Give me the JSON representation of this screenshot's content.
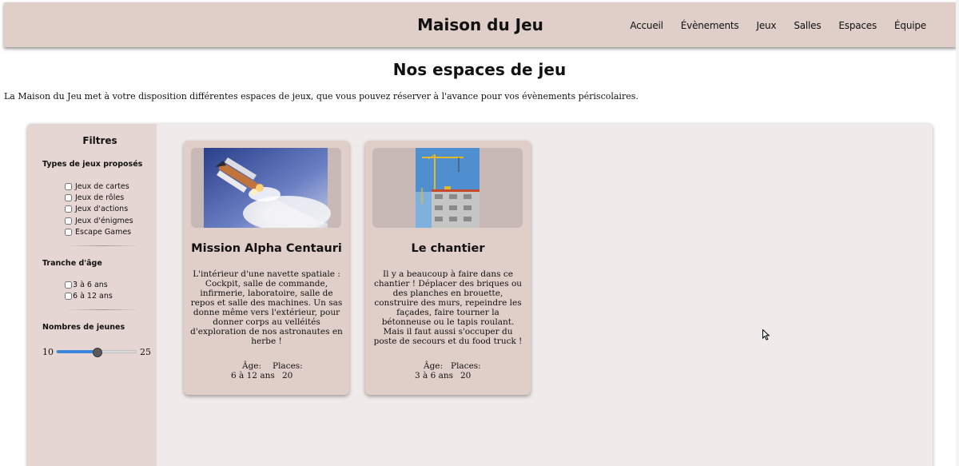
{
  "header": {
    "site_title": "Maison du Jeu",
    "nav": [
      {
        "label": "Accueil"
      },
      {
        "label": "Évènements"
      },
      {
        "label": "Jeux"
      },
      {
        "label": "Salles"
      },
      {
        "label": "Espaces"
      },
      {
        "label": "Équipe"
      }
    ]
  },
  "main": {
    "heading": "Nos espaces de jeu",
    "intro": "La Maison du Jeu met à votre disposition différentes espaces de jeux, que vous pouvez réserver à l'avance pour vos évènements périscolaires."
  },
  "filters": {
    "title": "Filtres",
    "game_types": {
      "title": "Types de jeux proposés",
      "options": [
        {
          "label": "Jeux de cartes",
          "checked": false
        },
        {
          "label": "Jeux de rôles",
          "checked": false
        },
        {
          "label": "Jeux d'actions",
          "checked": false
        },
        {
          "label": "Jeux d'énigmes",
          "checked": false
        },
        {
          "label": "Escape Games",
          "checked": false
        }
      ]
    },
    "age_range": {
      "title": "Tranche d'âge",
      "options": [
        {
          "label": "3 à 6 ans",
          "checked": false
        },
        {
          "label": "6 à 12 ans",
          "checked": false
        }
      ]
    },
    "players": {
      "title": "Nombres de jeunes",
      "min_label": "10",
      "max_label": "25",
      "value_fraction": 0.5
    }
  },
  "cards": [
    {
      "title": "Mission Alpha Centauri",
      "image_icon": "space-shuttle-launch-photo",
      "description": "L'intérieur d'une navette spatiale : Cockpit, salle de commande, infirmerie, laboratoire, salle de repos et salle des machines. Un sas donne même vers l'extérieur, pour donner corps au velléités d'exploration de nos astronautes en herbe !",
      "age_label": "Âge:",
      "age_value": "6 à 12 ans",
      "places_label": "Places:",
      "places_value": "20"
    },
    {
      "title": "Le chantier",
      "image_icon": "construction-site-photo",
      "description": "Il y a beaucoup à faire dans ce chantier ! Déplacer des briques ou des planches en brouette, construire des murs, repeindre les façades, faire tourner la bétonneuse ou le tapis roulant. Mais il faut aussi s'occuper du poste de secours et du food truck !",
      "age_label": "Âge:",
      "age_value": "3 à 6 ans",
      "places_label": "Places:",
      "places_value": "20"
    }
  ],
  "colors": {
    "header_bg": "#e0cec9",
    "sidebar_bg": "#e6d6d3",
    "panel_bg": "#f1eaea",
    "card_bg": "#e0cec9",
    "slider_accent": "#3b86d8"
  }
}
